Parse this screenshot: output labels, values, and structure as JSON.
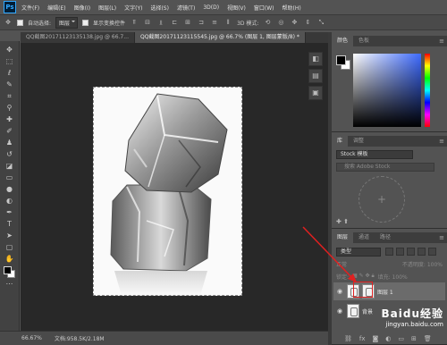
{
  "app": {
    "logo": "Ps"
  },
  "menu": [
    "文件(F)",
    "编辑(E)",
    "图像(I)",
    "图层(L)",
    "文字(Y)",
    "选择(S)",
    "滤镜(T)",
    "3D(D)",
    "视图(V)",
    "窗口(W)",
    "帮助(H)"
  ],
  "options": {
    "auto_select_label": "自动选择:",
    "auto_select_value": "图层",
    "show_transform_label": "显示变换控件",
    "mode_3d": "3D 模式:"
  },
  "doc_tabs": [
    {
      "label": "QQ截图20171123135138.jpg @ 66.7...",
      "active": false
    },
    {
      "label": "QQ截图20171123115545.jpg @ 66.7% (图层 1, 图层蒙版/8) *",
      "active": true
    }
  ],
  "status": {
    "zoom": "66.67%",
    "doc": "文档:958.5K/2.18M"
  },
  "panels": {
    "color_tabs": [
      "颜色",
      "色板"
    ],
    "library_tabs": [
      "库",
      "调整"
    ],
    "library_select": "Stock 模板",
    "library_search_placeholder": "搜索 Adobe Stock",
    "layers_tabs": [
      "图层",
      "通道",
      "路径"
    ],
    "layer_filter": "类型",
    "blend_mode": "正常",
    "opacity": "不透明度: 100%",
    "lock_label": "锁定:",
    "fill": "填充: 100%",
    "layers": [
      {
        "name": "图层 1",
        "selected": true,
        "has_mask": true
      },
      {
        "name": "背景",
        "selected": false,
        "has_mask": false
      }
    ]
  },
  "watermark": {
    "title": "Baidu经验",
    "url": "jingyan.baidu.com"
  },
  "colors": {
    "annotation": "#e02020",
    "selected_row": "#6b6b6b"
  }
}
